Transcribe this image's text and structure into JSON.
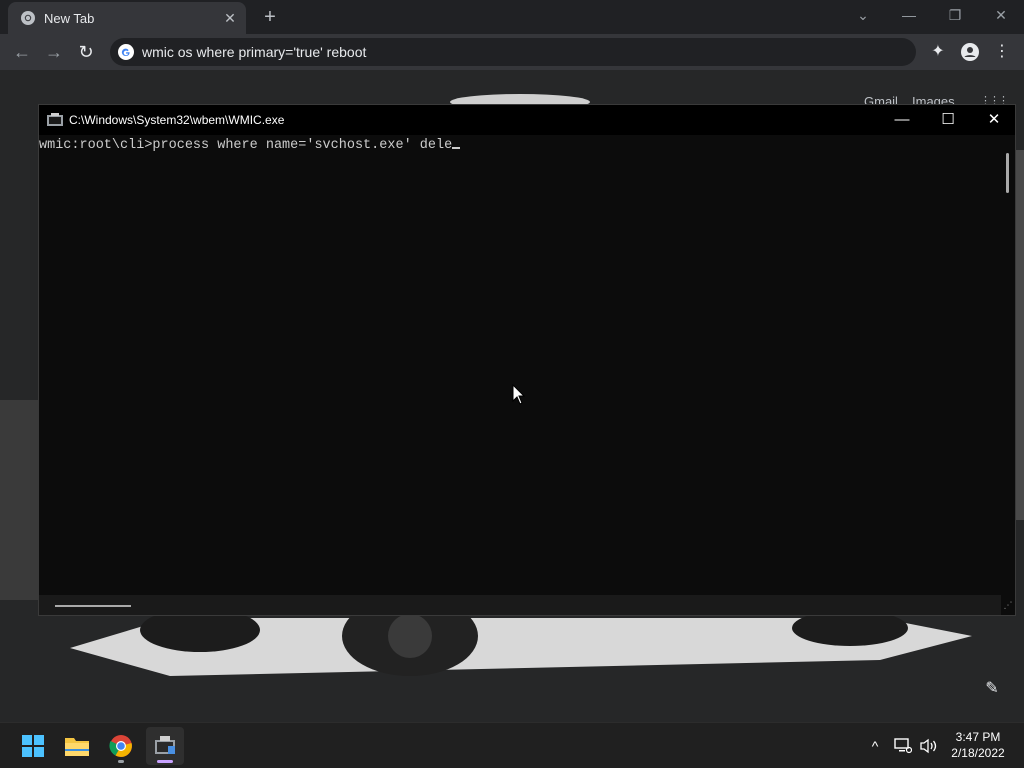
{
  "browser": {
    "tab": {
      "title": "New Tab",
      "close_glyph": "✕",
      "new_tab_glyph": "+"
    },
    "window_controls": {
      "dropdown_glyph": "⌄",
      "minimize_glyph": "—",
      "restore_glyph": "❐",
      "close_glyph": "✕"
    },
    "toolbar": {
      "back_glyph": "←",
      "forward_glyph": "→",
      "reload_glyph": "↻",
      "address": "wmic os where primary='true' reboot",
      "extensions_glyph": "✦",
      "menu_glyph": "⋮"
    },
    "newtab_page": {
      "gmail": "Gmail",
      "images": "Images",
      "apps_glyph": "⋮⋮⋮",
      "customize_glyph": "✎"
    }
  },
  "console": {
    "title": "C:\\Windows\\System32\\wbem\\WMIC.exe",
    "prompt": "wmic:root\\cli>",
    "command": "process where name='svchost.exe' dele",
    "minimize_glyph": "—",
    "maximize_glyph": "☐",
    "close_glyph": "✕",
    "grip_glyph": "⋰"
  },
  "taskbar": {
    "tray": {
      "chevron_glyph": "^"
    },
    "clock": {
      "time": "3:47 PM",
      "date": "2/18/2022"
    }
  },
  "colors": {
    "console_bg": "#0c0c0c",
    "console_text": "#cccccc",
    "chrome_bg": "#202124",
    "active_indicator": "#c8a2ff"
  }
}
